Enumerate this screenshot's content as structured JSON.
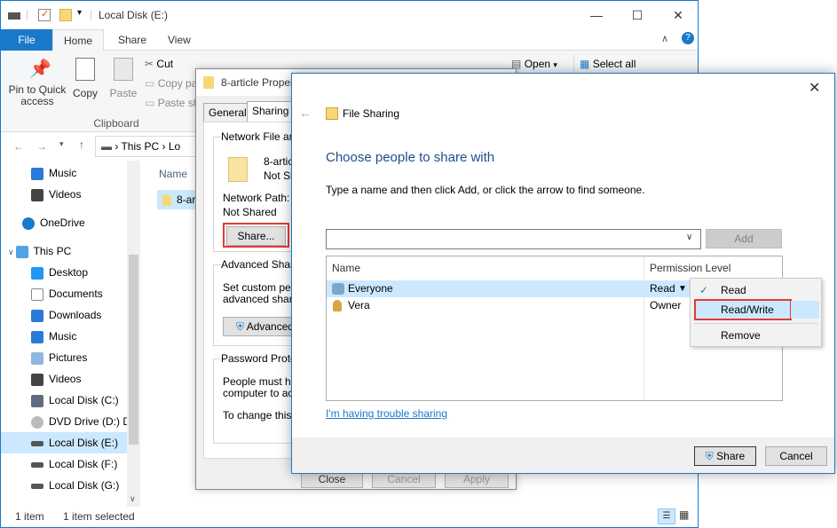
{
  "explorer": {
    "title": "Local Disk (E:)",
    "tabs": [
      "File",
      "Home",
      "Share",
      "View"
    ],
    "ribbon": {
      "pin_label": "Pin to Quick access",
      "copy_label": "Copy",
      "paste_label": "Paste",
      "cut_label": "Cut",
      "copy_path_label": "Copy pa",
      "paste_shortcut_label": "Paste sh",
      "clipboard_group": "Clipboard",
      "open_label": "Open",
      "select_all_label": "Select all"
    },
    "address": {
      "this_pc": "This PC",
      "sep": "Lo"
    },
    "column_name": "Name",
    "file_item": "8-ar",
    "nav": [
      "Music",
      "Videos",
      "OneDrive",
      "This PC",
      "Desktop",
      "Documents",
      "Downloads",
      "Music",
      "Pictures",
      "Videos",
      "Local Disk (C:)",
      "DVD Drive (D:) D",
      "Local Disk (E:)",
      "Local Disk (F:)",
      "Local Disk (G:)"
    ],
    "status": {
      "items": "1 item",
      "selected": "1 item selected"
    }
  },
  "props": {
    "title": "8-article Proper",
    "tabs": [
      "General",
      "Sharing"
    ],
    "network_group": "Network File and",
    "file_name": "8-article",
    "file_state": "Not Sh",
    "network_path_label": "Network Path:",
    "network_path_value": "Not Shared",
    "share_button": "Share...",
    "advanced_group": "Advanced Sharin",
    "advanced_text1": "Set custom perm",
    "advanced_text2": "advanced sharin",
    "advanced_button": "Advanced",
    "password_group": "Password Protec",
    "password_text1": "People must hav",
    "password_text2": "computer to acc",
    "password_text3": "To change this s",
    "close_button": "Close",
    "cancel_button": "Cancel",
    "apply_button": "Apply"
  },
  "share": {
    "window_title": "File Sharing",
    "heading": "Choose people to share with",
    "instruction": "Type a name and then click Add, or click the arrow to find someone.",
    "add_button": "Add",
    "col_name": "Name",
    "col_perm": "Permission Level",
    "rows": [
      {
        "name": "Everyone",
        "perm": "Read"
      },
      {
        "name": "Vera",
        "perm": "Owner"
      }
    ],
    "trouble_link": "I'm having trouble sharing",
    "share_button": "Share",
    "cancel_button": "Cancel"
  },
  "menu": {
    "read": "Read",
    "read_write": "Read/Write",
    "remove": "Remove"
  },
  "colors": {
    "accent": "#1979ca",
    "heading": "#1e4e8c",
    "highlight": "#cce8ff",
    "red_box": "#e53935"
  }
}
